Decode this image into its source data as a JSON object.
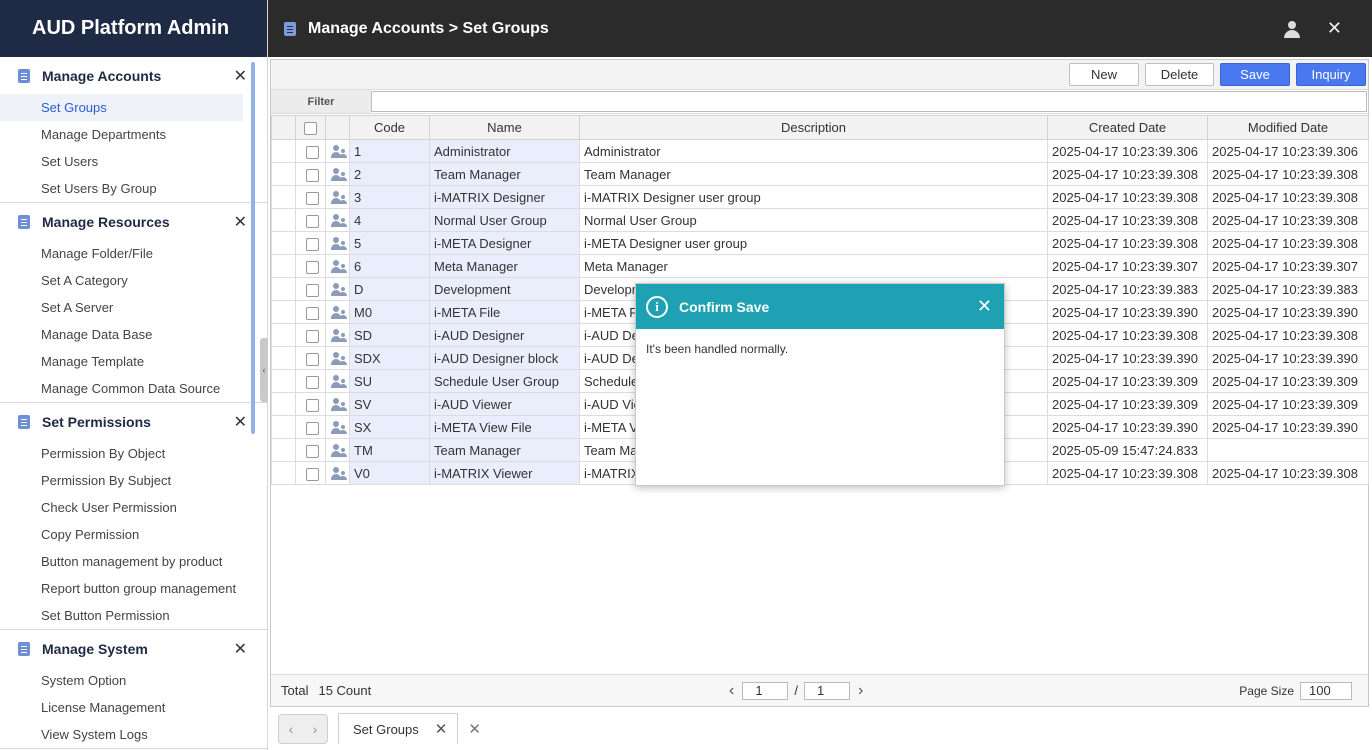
{
  "brand": "AUD Platform Admin",
  "header": {
    "title": "Manage Accounts > Set Groups"
  },
  "sidebar": {
    "sections": [
      {
        "title": "Manage Accounts",
        "items": [
          "Set Groups",
          "Manage Departments",
          "Set Users",
          "Set Users By Group"
        ]
      },
      {
        "title": "Manage Resources",
        "items": [
          "Manage Folder/File",
          "Set A Category",
          "Set A Server",
          "Manage Data Base",
          "Manage Template",
          "Manage Common Data Source"
        ]
      },
      {
        "title": "Set Permissions",
        "items": [
          "Permission By Object",
          "Permission By Subject",
          "Check User Permission",
          "Copy Permission",
          "Button management by product",
          "Report button group management",
          "Set Button Permission"
        ]
      },
      {
        "title": "Manage System",
        "items": [
          "System Option",
          "License Management",
          "View System Logs"
        ]
      }
    ]
  },
  "toolbar": {
    "new_label": "New",
    "delete_label": "Delete",
    "save_label": "Save",
    "inquiry_label": "Inquiry"
  },
  "filter": {
    "label": "Filter",
    "value": ""
  },
  "table": {
    "columns": [
      "Code",
      "Name",
      "Description",
      "Created Date",
      "Modified Date"
    ],
    "rows": [
      [
        "1",
        "Administrator",
        "Administrator",
        "2025-04-17 10:23:39.306",
        "2025-04-17 10:23:39.306"
      ],
      [
        "2",
        "Team Manager",
        "Team Manager",
        "2025-04-17 10:23:39.308",
        "2025-04-17 10:23:39.308"
      ],
      [
        "3",
        "i-MATRIX Designer",
        "i-MATRIX Designer user group",
        "2025-04-17 10:23:39.308",
        "2025-04-17 10:23:39.308"
      ],
      [
        "4",
        "Normal User Group",
        "Normal User Group",
        "2025-04-17 10:23:39.308",
        "2025-04-17 10:23:39.308"
      ],
      [
        "5",
        "i-META Designer",
        "i-META Designer user group",
        "2025-04-17 10:23:39.308",
        "2025-04-17 10:23:39.308"
      ],
      [
        "6",
        "Meta Manager",
        "Meta Manager",
        "2025-04-17 10:23:39.307",
        "2025-04-17 10:23:39.307"
      ],
      [
        "D",
        "Development",
        "Developm",
        "2025-04-17 10:23:39.383",
        "2025-04-17 10:23:39.383"
      ],
      [
        "M0",
        "i-META File",
        "i-META F",
        "2025-04-17 10:23:39.390",
        "2025-04-17 10:23:39.390"
      ],
      [
        "SD",
        "i-AUD Designer",
        "i-AUD De",
        "2025-04-17 10:23:39.308",
        "2025-04-17 10:23:39.308"
      ],
      [
        "SDX",
        "i-AUD Designer block",
        "i-AUD De",
        "2025-04-17 10:23:39.390",
        "2025-04-17 10:23:39.390"
      ],
      [
        "SU",
        "Schedule User Group",
        "Schedule",
        "2025-04-17 10:23:39.309",
        "2025-04-17 10:23:39.309"
      ],
      [
        "SV",
        "i-AUD Viewer",
        "i-AUD Vie",
        "2025-04-17 10:23:39.309",
        "2025-04-17 10:23:39.309"
      ],
      [
        "SX",
        "i-META View File",
        "i-META V",
        "2025-04-17 10:23:39.390",
        "2025-04-17 10:23:39.390"
      ],
      [
        "TM",
        "Team Manager",
        "Team Ma",
        "2025-05-09 15:47:24.833",
        ""
      ],
      [
        "V0",
        "i-MATRIX Viewer",
        "i-MATRIX",
        "2025-04-17 10:23:39.308",
        "2025-04-17 10:23:39.308"
      ]
    ]
  },
  "pager": {
    "total_label": "Total",
    "count_label": "15 Count",
    "current_page": "1",
    "slash": "/",
    "total_pages": "1",
    "page_size_label": "Page Size",
    "page_size": "100"
  },
  "tabs": [
    {
      "label": "Set Groups"
    }
  ],
  "dialog": {
    "title": "Confirm Save",
    "message": "It's been handled normally."
  },
  "icons": {
    "info": "i",
    "close": "✕"
  },
  "colors": {
    "brand_bg": "#1f2a44",
    "topbar_bg": "#2b2b2b",
    "primary_button": "#4a78f0",
    "dialog_header": "#1da1b3",
    "active_menu_text": "#2b5ed6"
  }
}
